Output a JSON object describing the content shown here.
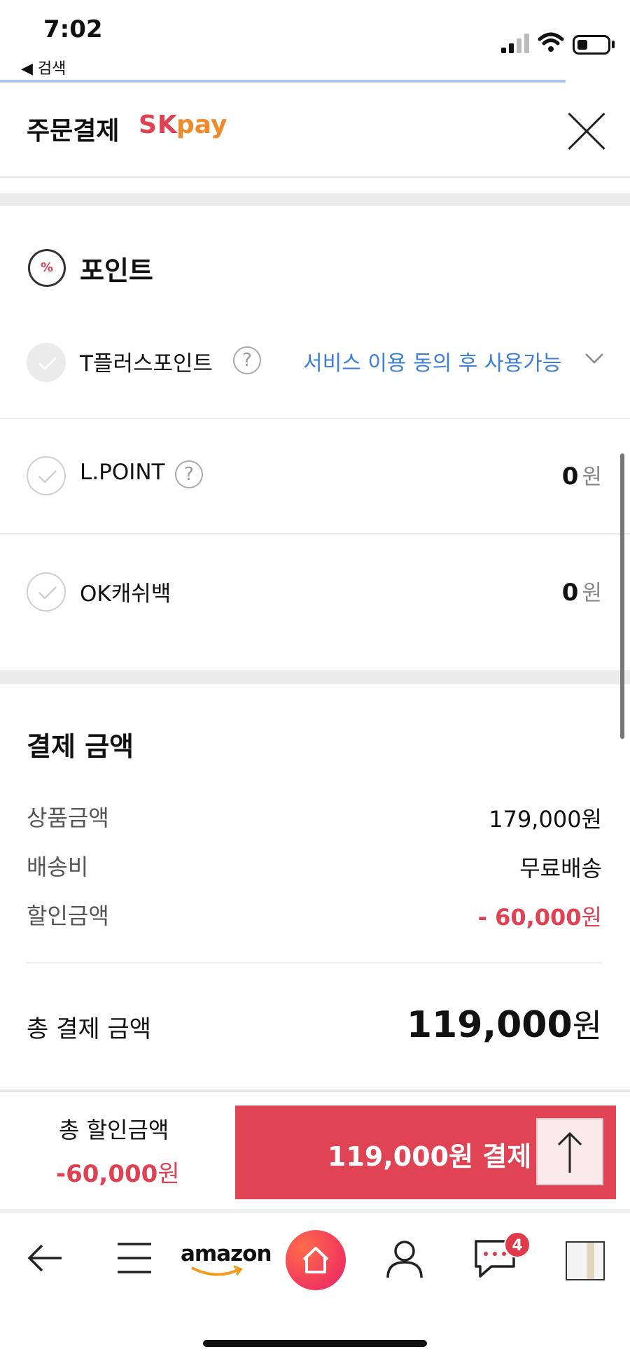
{
  "status_bar": {
    "time": "7:02",
    "back_app": "◀ 검색"
  },
  "header": {
    "title": "주문결제",
    "brand_sk": "SK",
    "brand_pay": "pay"
  },
  "points": {
    "icon_text": "%",
    "title": "포인트",
    "rows": [
      {
        "label": "T플러스포인트",
        "help": "?",
        "action": "서비스 이용 동의 후 사용가능",
        "checked": true
      },
      {
        "label": "L.POINT",
        "help": "?",
        "amount": "0",
        "unit": "원"
      },
      {
        "label": "OK캐쉬백",
        "amount": "0",
        "unit": "원"
      }
    ]
  },
  "payment": {
    "title": "결제 금액",
    "lines": [
      {
        "label": "상품금액",
        "value": "179,000원"
      },
      {
        "label": "배송비",
        "value": "무료배송"
      },
      {
        "label": "할인금액",
        "value_num": "- 60,000",
        "value_unit": "원"
      }
    ],
    "total_label": "총 결제 금액",
    "total_num": "119,000",
    "total_unit": "원"
  },
  "pay_bar": {
    "discount_label": "총 할인금액",
    "discount_num": "-60,000",
    "discount_unit": "원",
    "button_label": "119,000원 결제"
  },
  "browser_nav": {
    "amazon": "amazon",
    "badge_count": "4"
  },
  "colors": {
    "accent_red": "#e04253",
    "link_blue": "#3d7fd6",
    "pay_orange": "#f08a2a"
  }
}
